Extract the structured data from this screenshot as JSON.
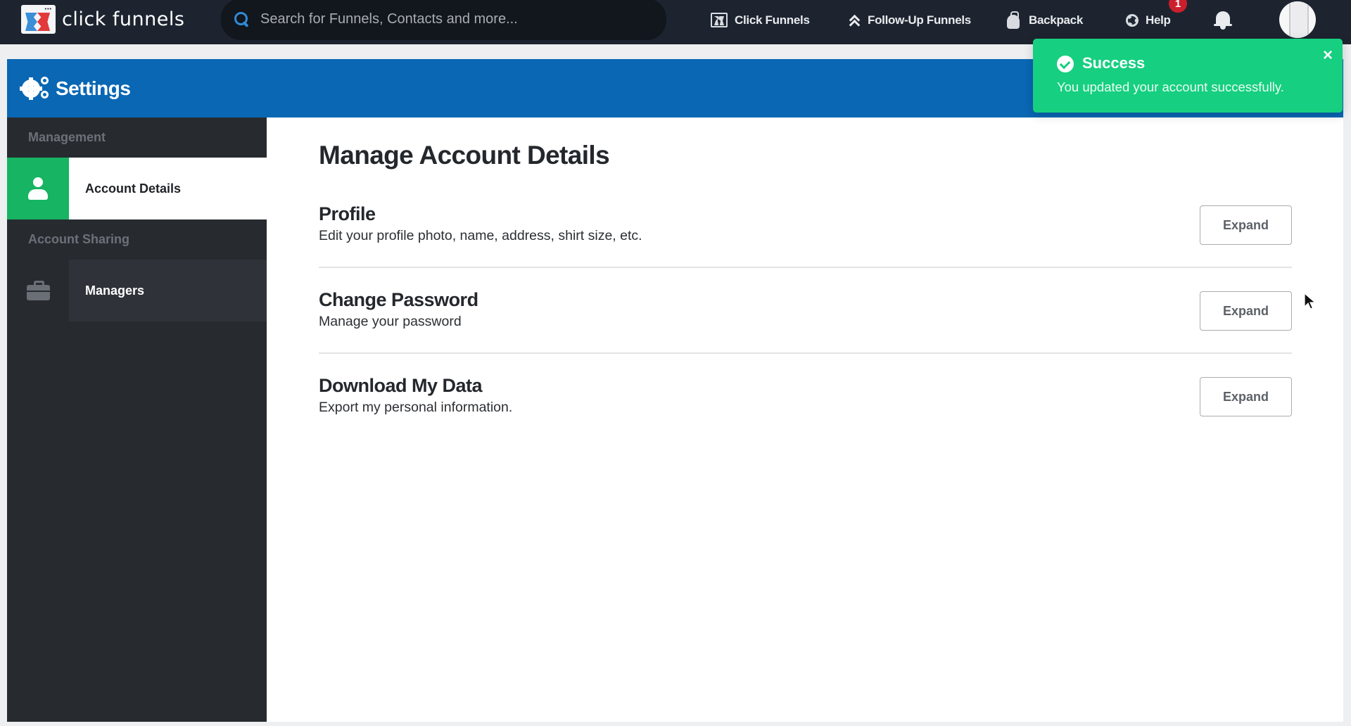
{
  "topbar": {
    "logo_text": "click funnels",
    "search": {
      "placeholder": "Search for Funnels, Contacts and more...",
      "value": ""
    },
    "nav": [
      {
        "label": "Click Funnels",
        "icon": "clickfunnels-icon"
      },
      {
        "label": "Follow-Up Funnels",
        "icon": "chevrons-up-icon"
      },
      {
        "label": "Backpack",
        "icon": "backpack-icon"
      },
      {
        "label": "Help",
        "icon": "lifebuoy-icon"
      }
    ],
    "notification_count": "1"
  },
  "header": {
    "title": "Settings",
    "icon": "gears-icon"
  },
  "sidebar": {
    "sections": [
      {
        "title": "Management",
        "items": [
          {
            "label": "Account Details",
            "icon": "user-icon",
            "active": true
          }
        ]
      },
      {
        "title": "Account Sharing",
        "items": [
          {
            "label": "Managers",
            "icon": "briefcase-icon",
            "active": false
          }
        ]
      }
    ]
  },
  "main": {
    "title": "Manage Account Details",
    "sections": [
      {
        "heading": "Profile",
        "description": "Edit your profile photo, name, address, shirt size, etc.",
        "button": "Expand"
      },
      {
        "heading": "Change Password",
        "description": "Manage your password",
        "button": "Expand"
      },
      {
        "heading": "Download My Data",
        "description": "Export my personal information.",
        "button": "Expand"
      }
    ]
  },
  "toast": {
    "title": "Success",
    "message": "You updated your account successfully.",
    "close": "×",
    "color": "#16cf80"
  },
  "colors": {
    "topbar": "#1d2430",
    "header_blue": "#0967b4",
    "sidebar": "#272b30",
    "active_green": "#16b463",
    "badge_red": "#cc1f2e"
  }
}
